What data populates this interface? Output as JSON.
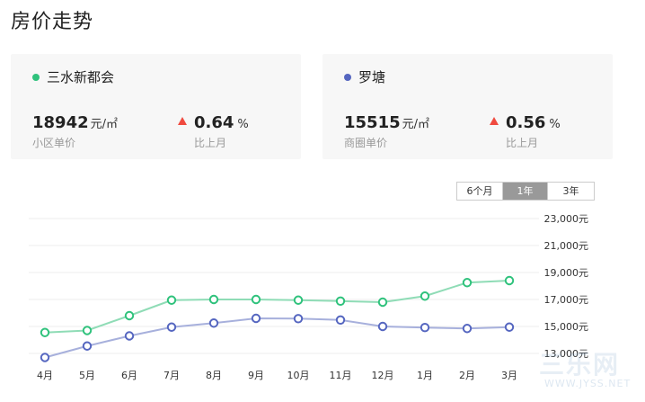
{
  "page_title": "房价走势",
  "cards": [
    {
      "name": "三水新都会",
      "color": "#2fc27c",
      "price": "18942",
      "unit": "元/㎡",
      "price_label": "小区单价",
      "change": "0.64",
      "change_unit": "%",
      "change_label": "比上月"
    },
    {
      "name": "罗塘",
      "color": "#5566c0",
      "price": "15515",
      "unit": "元/㎡",
      "price_label": "商圈单价",
      "change": "0.56",
      "change_unit": "%",
      "change_label": "比上月"
    }
  ],
  "tabs": [
    {
      "label": "6个月",
      "active": false
    },
    {
      "label": "1年",
      "active": true
    },
    {
      "label": "3年",
      "active": false
    }
  ],
  "watermark": {
    "main": "三乐网",
    "sub": "WWW.JYSS.NET"
  },
  "chart_data": {
    "type": "line",
    "categories": [
      "4月",
      "5月",
      "6月",
      "7月",
      "8月",
      "9月",
      "10月",
      "11月",
      "12月",
      "1月",
      "2月",
      "3月"
    ],
    "series": [
      {
        "name": "三水新都会",
        "color": "#2fc27c",
        "values": [
          14550,
          14700,
          15800,
          16950,
          17000,
          17000,
          16950,
          16880,
          16800,
          17250,
          18250,
          18400
        ]
      },
      {
        "name": "罗塘",
        "color": "#5566c0",
        "values": [
          12700,
          13550,
          14300,
          14950,
          15250,
          15600,
          15580,
          15480,
          15000,
          14920,
          14850,
          14950
        ]
      }
    ],
    "y_ticks": [
      "23,000元",
      "21,000元",
      "19,000元",
      "17,000元",
      "15,000元",
      "13,000元"
    ],
    "y_tick_values": [
      23000,
      21000,
      19000,
      17000,
      15000,
      13000
    ],
    "ylim": [
      12300,
      23000
    ],
    "grid": true
  }
}
